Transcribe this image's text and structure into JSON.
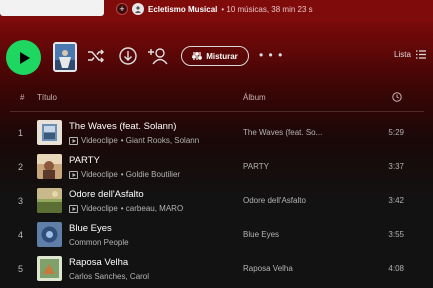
{
  "playlist": {
    "owner": "Ecletismo Musical",
    "stats": "• 10 músicas, 38 min 23 s"
  },
  "toolbar": {
    "shuffle_label": "Misturar",
    "list_label": "Lista",
    "more_label": "• • •"
  },
  "table": {
    "headers": {
      "number": "#",
      "title": "Título",
      "album": "Álbum"
    },
    "rows": [
      {
        "num": "1",
        "title": "The Waves (feat. Solann)",
        "video": true,
        "artists": "• Giant Rooks, Solann",
        "video_label": "Videoclipe",
        "album": "The Waves (feat. So...",
        "duration": "5:29"
      },
      {
        "num": "2",
        "title": "PARTY",
        "video": true,
        "artists": "• Goldie Boutilier",
        "video_label": "Videoclipe",
        "album": "PARTY",
        "duration": "3:37"
      },
      {
        "num": "3",
        "title": "Odore dell'Asfalto",
        "video": true,
        "artists": "• carbeau, MARO",
        "video_label": "Videoclipe",
        "album": "Odore dell'Asfalto",
        "duration": "3:42"
      },
      {
        "num": "4",
        "title": "Blue Eyes",
        "video": false,
        "artists": "Common People",
        "album": "Blue Eyes",
        "duration": "3:55"
      },
      {
        "num": "5",
        "title": "Raposa Velha",
        "video": false,
        "artists": "Carlos Sanches, Carol",
        "album": "Raposa Velha",
        "duration": "4:08"
      }
    ]
  },
  "colors": {
    "accent_green": "#1ed760",
    "header_red": "#7f0b0b",
    "background": "#121212"
  },
  "icons": [
    "plus-icon",
    "play-icon",
    "shuffle-icon",
    "download-icon",
    "add-user-icon",
    "sliders-icon",
    "list-icon",
    "clock-icon",
    "video-icon"
  ]
}
